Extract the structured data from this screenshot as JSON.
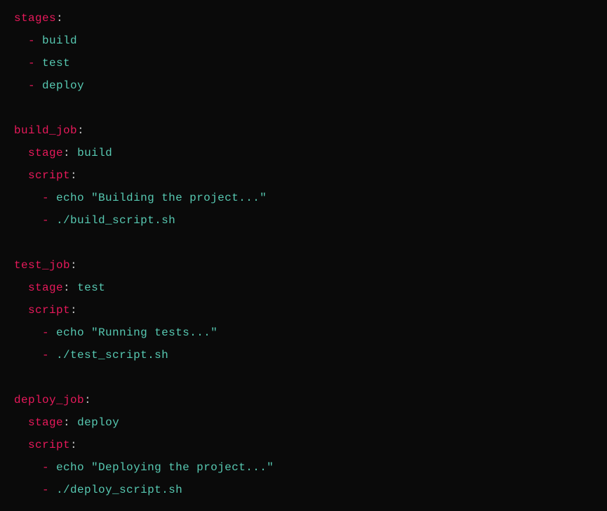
{
  "yaml": {
    "stages_key": "stages",
    "stages": [
      "build",
      "test",
      "deploy"
    ],
    "jobs": [
      {
        "name": "build_job",
        "stage_key": "stage",
        "stage_value": "build",
        "script_key": "script",
        "script_lines": [
          "echo \"Building the project...\"",
          "./build_script.sh"
        ]
      },
      {
        "name": "test_job",
        "stage_key": "stage",
        "stage_value": "test",
        "script_key": "script",
        "script_lines": [
          "echo \"Running tests...\"",
          "./test_script.sh"
        ]
      },
      {
        "name": "deploy_job",
        "stage_key": "stage",
        "stage_value": "deploy",
        "script_key": "script",
        "script_lines": [
          "echo \"Deploying the project...\"",
          "./deploy_script.sh"
        ]
      }
    ]
  },
  "tokens": {
    "colon": ":",
    "dash": "-"
  }
}
